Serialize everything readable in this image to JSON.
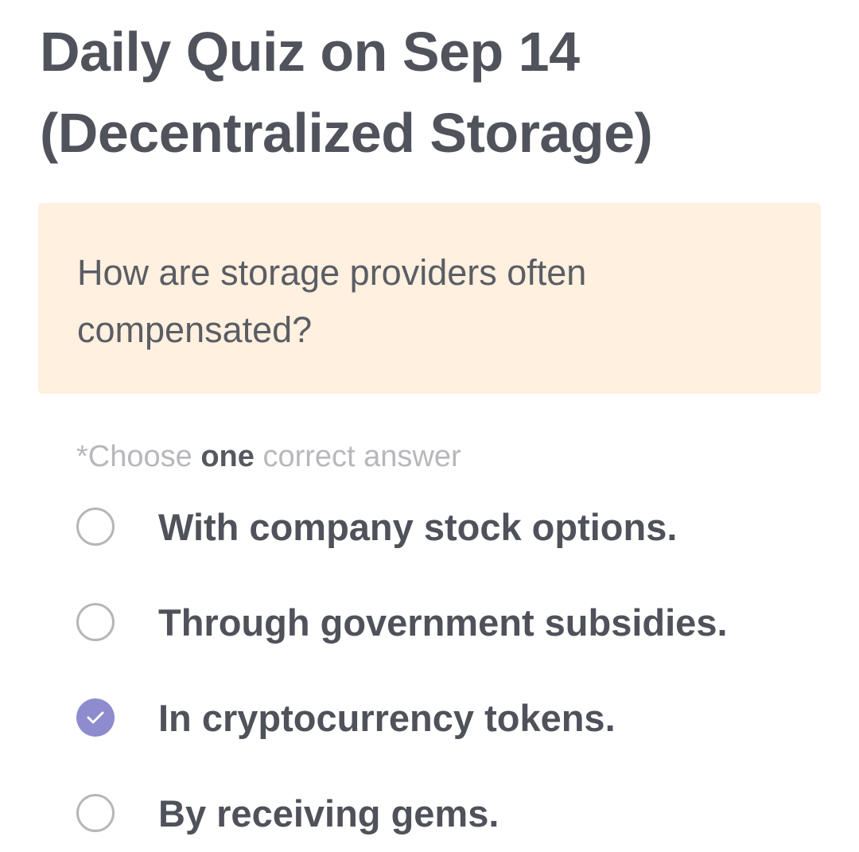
{
  "quiz": {
    "title_line1": "Daily Quiz on Sep 14",
    "title_line2": "(Decentralized Storage)",
    "question": "How are storage providers often compensated?",
    "instruction_prefix": "*Choose ",
    "instruction_emphasis": "one",
    "instruction_suffix": " correct answer",
    "selected_option_index": 2,
    "accent_color": "#8c8ccf",
    "card_background": "#fff0df",
    "options": [
      {
        "label": "With company stock options.",
        "selected": false,
        "icon": "radio-unchecked-icon"
      },
      {
        "label": "Through government subsidies.",
        "selected": false,
        "icon": "radio-unchecked-icon"
      },
      {
        "label": "In cryptocurrency tokens.",
        "selected": true,
        "icon": "radio-checked-icon"
      },
      {
        "label": "By receiving gems.",
        "selected": false,
        "icon": "radio-unchecked-icon"
      }
    ]
  }
}
